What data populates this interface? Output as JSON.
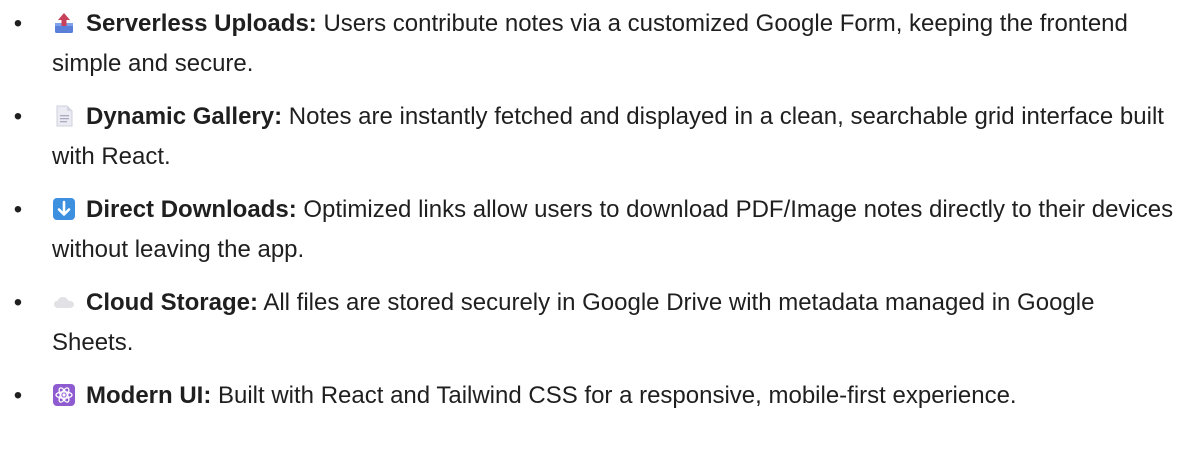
{
  "features": [
    {
      "icon": "outbox-tray-icon",
      "title": "Serverless Uploads:",
      "text": " Users contribute notes via a customized Google Form, keeping the frontend simple and secure."
    },
    {
      "icon": "page-icon",
      "title": "Dynamic Gallery:",
      "text": " Notes are instantly fetched and displayed in a clean, searchable grid interface built with React."
    },
    {
      "icon": "down-arrow-icon",
      "title": "Direct Downloads:",
      "text": " Optimized links allow users to download PDF/Image notes directly to their devices without leaving the app."
    },
    {
      "icon": "cloud-icon",
      "title": "Cloud Storage:",
      "text": " All files are stored securely in Google Drive with metadata managed in Google Sheets."
    },
    {
      "icon": "atom-icon",
      "title": "Modern UI:",
      "text": " Built with React and Tailwind CSS for a responsive, mobile-first experience."
    }
  ],
  "colors": {
    "text": "#1f1f1f",
    "outbox_tray": "#c8415a",
    "down_arrow": "#3d8fe0",
    "atom": "#8e5bd0"
  }
}
